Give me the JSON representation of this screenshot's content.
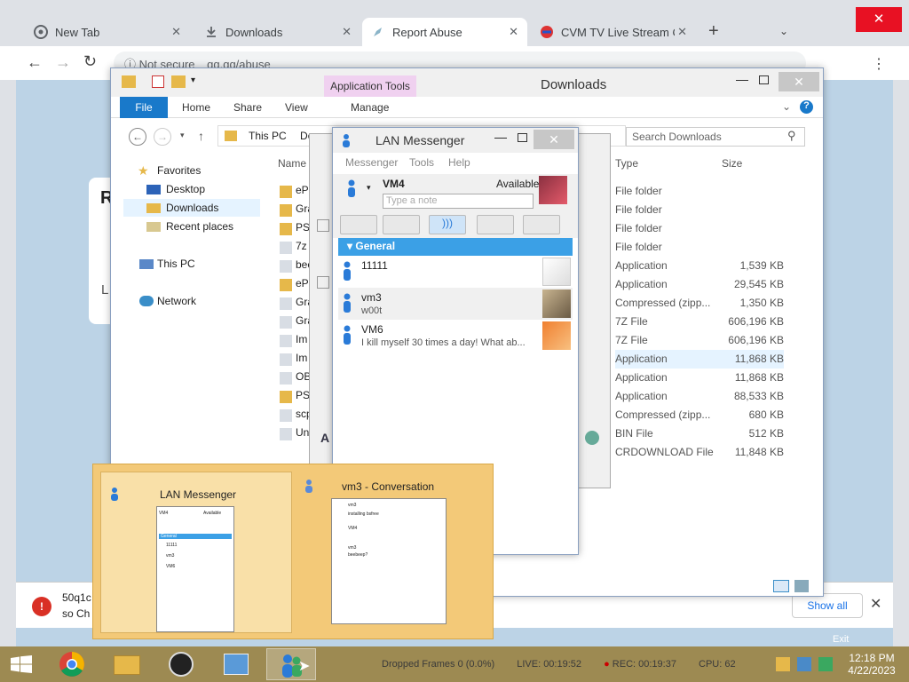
{
  "chrome": {
    "tabs": [
      {
        "label": "New Tab"
      },
      {
        "label": "Downloads"
      },
      {
        "label": "Report Abuse"
      },
      {
        "label": "CVM TV Live Stream On"
      }
    ],
    "omnibox": {
      "security": "Not secure",
      "url": "gg.gg/abuse"
    },
    "download_bar": {
      "file_line1": "50q1c",
      "file_line2": "so Ch",
      "show_all": "Show all"
    },
    "card_partial": {
      "r": "R",
      "l": "L"
    }
  },
  "explorer": {
    "title": "Downloads",
    "app_tools": "Application Tools",
    "ribbon_tabs": [
      "File",
      "Home",
      "Share",
      "View",
      "Manage"
    ],
    "address": "This PC",
    "address_next": "Dow",
    "search_placeholder": "Search Downloads",
    "nav": {
      "favorites": "Favorites",
      "desktop": "Desktop",
      "downloads": "Downloads",
      "recent": "Recent places",
      "thispc": "This PC",
      "network": "Network"
    },
    "columns": {
      "name": "Name",
      "type": "Type",
      "size": "Size"
    },
    "file_name_fragments": [
      "eP",
      "Gra",
      "PS",
      "7z",
      "bee",
      "eP",
      "Gra",
      "Gra",
      "Im",
      "Im",
      "OB",
      "PS",
      "scp",
      "Un"
    ],
    "files": [
      {
        "type": "File folder",
        "size": ""
      },
      {
        "type": "File folder",
        "size": ""
      },
      {
        "type": "File folder",
        "size": ""
      },
      {
        "type": "File folder",
        "size": ""
      },
      {
        "type": "Application",
        "size": "1,539 KB"
      },
      {
        "type": "Application",
        "size": "29,545 KB"
      },
      {
        "type": "Compressed (zipp...",
        "size": "1,350 KB"
      },
      {
        "type": "7Z File",
        "size": "606,196 KB"
      },
      {
        "type": "7Z File",
        "size": "606,196 KB"
      },
      {
        "type": "Application",
        "size": "11,868 KB"
      },
      {
        "type": "Application",
        "size": "11,868 KB"
      },
      {
        "type": "Application",
        "size": "88,533 KB"
      },
      {
        "type": "Compressed (zipp...",
        "size": "680 KB"
      },
      {
        "type": "BIN File",
        "size": "512 KB"
      },
      {
        "type": "CRDOWNLOAD File",
        "size": "11,848 KB"
      }
    ]
  },
  "lan": {
    "title": "LAN Messenger",
    "menu": [
      "Messenger",
      "Tools",
      "Help"
    ],
    "me": {
      "name": "VM4",
      "status": "Available",
      "note_placeholder": "Type a note"
    },
    "group": "General",
    "contacts": [
      {
        "name": "11111",
        "note": ""
      },
      {
        "name": "vm3",
        "note": "w00t"
      },
      {
        "name": "VM6",
        "note": "I kill myself 30 times a day! What ab..."
      }
    ]
  },
  "thumbs": {
    "one": "LAN Messenger",
    "two": "vm3 - Conversation",
    "mini_vm4": "VM4",
    "mini_available": "Available",
    "mini_group": "General",
    "mini_contacts": [
      "11111",
      "vm3",
      "VM6"
    ],
    "mini_conv": [
      "vm3",
      "installing bsfree",
      "VM4",
      "vm3",
      "beebeep?"
    ]
  },
  "taskbar": {
    "obs": {
      "dropped": "Dropped Frames 0 (0.0%)",
      "live": "LIVE: 00:19:52",
      "rec": "REC: 00:19:37",
      "cpu": "CPU: 62"
    },
    "exit": "Exit",
    "time": "12:18 PM",
    "date": "4/22/2023"
  }
}
